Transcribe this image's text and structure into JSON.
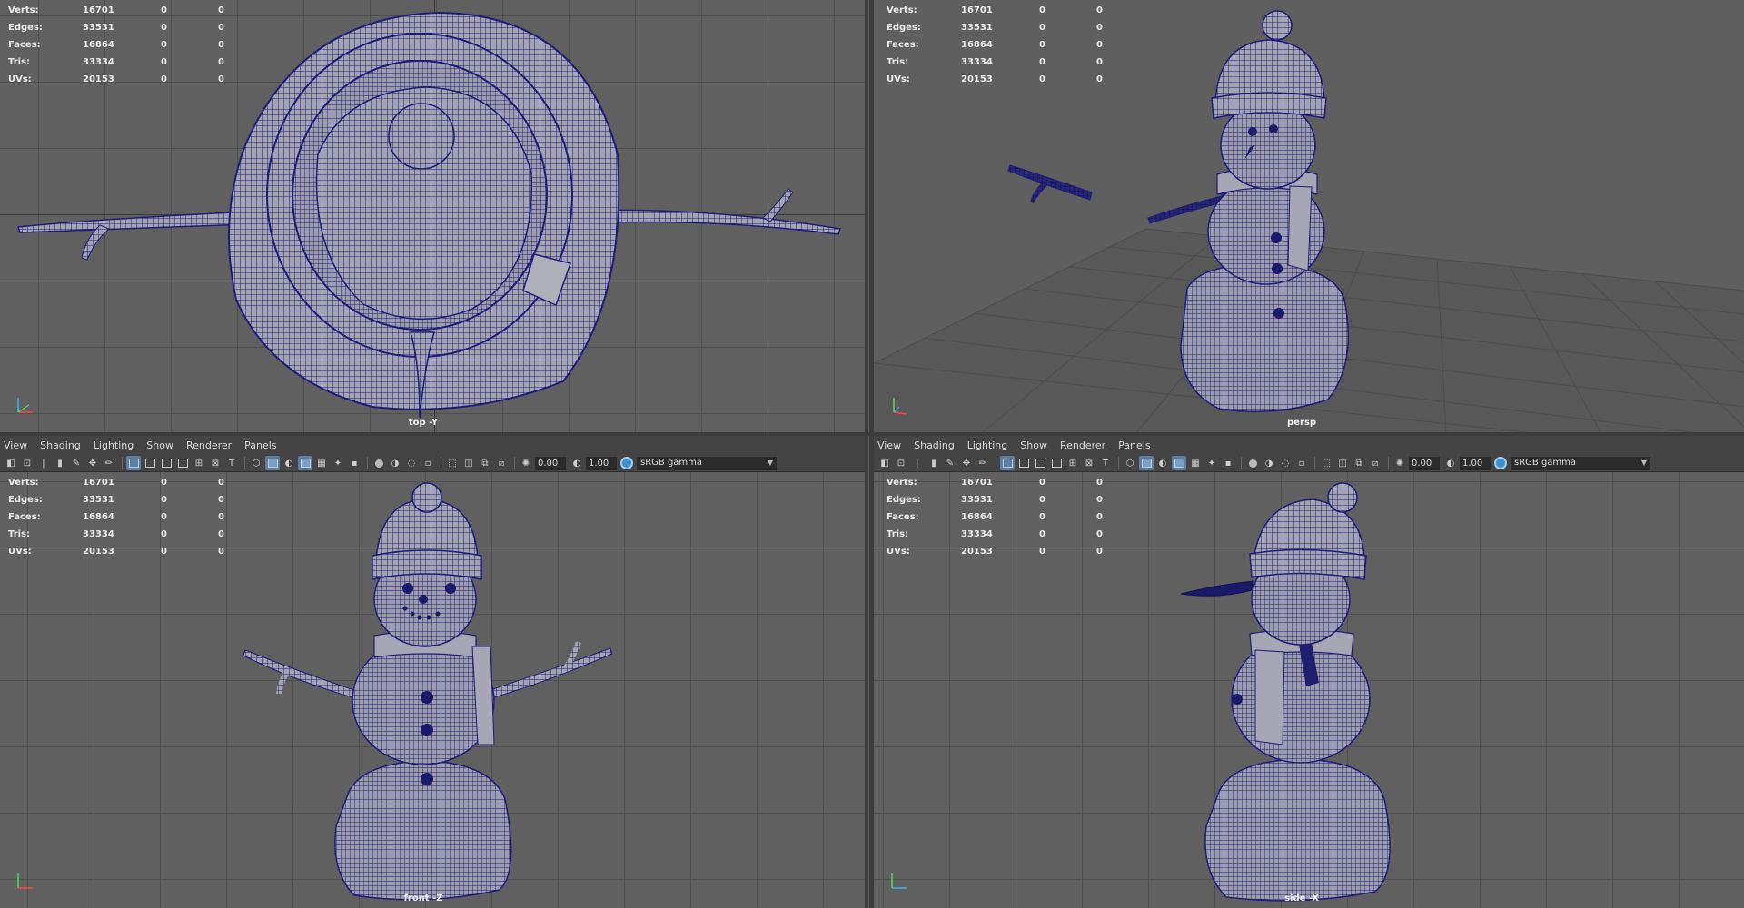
{
  "hud": {
    "rows": [
      {
        "label": "Verts:",
        "v1": "16701",
        "v2": "0",
        "v3": "0"
      },
      {
        "label": "Edges:",
        "v1": "33531",
        "v2": "0",
        "v3": "0"
      },
      {
        "label": "Faces:",
        "v1": "16864",
        "v2": "0",
        "v3": "0"
      },
      {
        "label": "Tris:",
        "v1": "33334",
        "v2": "0",
        "v3": "0"
      },
      {
        "label": "UVs:",
        "v1": "20153",
        "v2": "0",
        "v3": "0"
      }
    ]
  },
  "viewports": {
    "top": {
      "camera": "top -Y"
    },
    "persp": {
      "camera": "persp"
    },
    "front": {
      "camera": "front -Z"
    },
    "side": {
      "camera": "side -X"
    }
  },
  "panel_menu": [
    "View",
    "Shading",
    "Lighting",
    "Show",
    "Renderer",
    "Panels"
  ],
  "toolbar": {
    "exposure": "0.00",
    "gamma": "1.00",
    "color_space": "sRGB gamma"
  },
  "colors": {
    "viewport_bg": "#606060",
    "wire": "#1a1a7a",
    "mesh_fill": "#9a9aa6",
    "toolbar_bg": "#444444"
  }
}
